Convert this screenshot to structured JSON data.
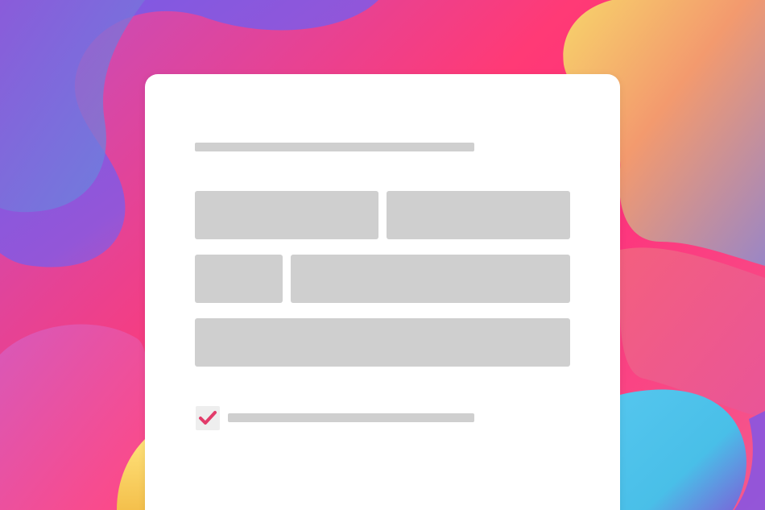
{
  "colors": {
    "background_pink": "#ff2f7a",
    "blob_purple": "#8a55e0",
    "blob_yellow": "#f7dc6a",
    "blob_cyan": "#4dc8ec",
    "card_background": "#ffffff",
    "placeholder_gray": "#cfcfcf",
    "checkbox_background": "#eeeeee",
    "checkmark": "#e23c6a"
  },
  "form": {
    "checkbox": {
      "checked": true,
      "icon": "checkmark-icon"
    }
  }
}
